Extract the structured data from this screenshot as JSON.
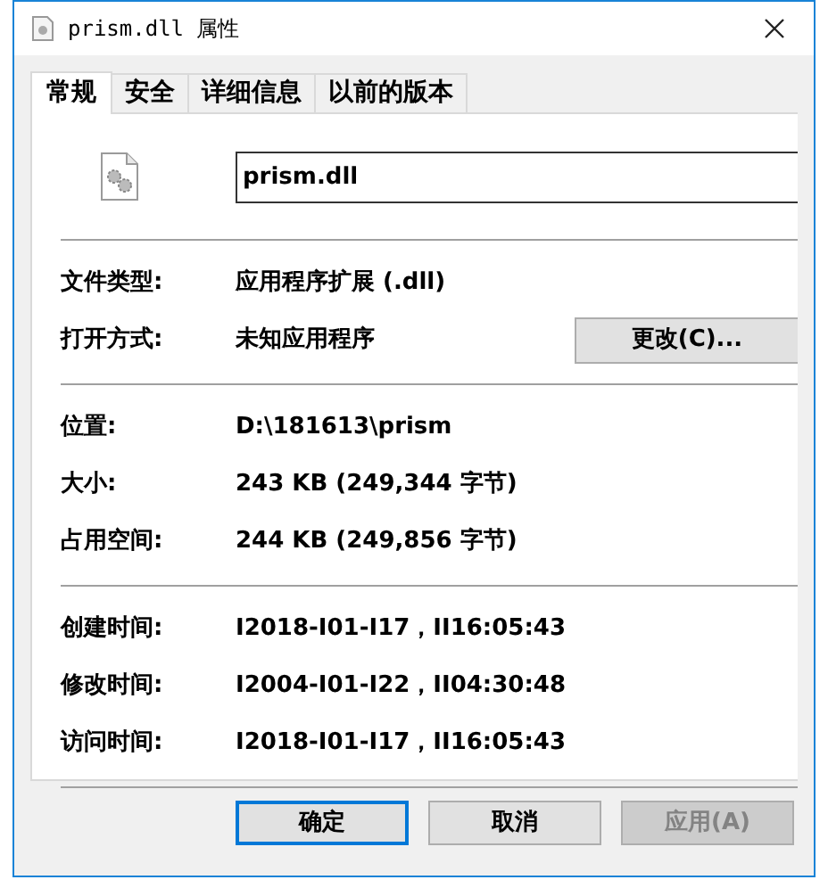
{
  "window": {
    "title": "prism.dll 属性"
  },
  "tabs": [
    {
      "label": "常规",
      "selected": true
    },
    {
      "label": "安全",
      "selected": false
    },
    {
      "label": "详细信息",
      "selected": false
    },
    {
      "label": "以前的版本",
      "selected": false
    }
  ],
  "file_name": {
    "value": "prism.dll"
  },
  "groups": [
    [
      {
        "label": "文件类型:",
        "value": "应用程序扩展 (.dll)"
      },
      {
        "label": "打开方式:",
        "value": "未知应用程序",
        "button": "更改(C)..."
      }
    ],
    [
      {
        "label": "位置:",
        "value": "D:\\181613\\prism"
      },
      {
        "label": "大小:",
        "value": "243 KB (249,344 字节)"
      },
      {
        "label": "占用空间:",
        "value": "244 KB (249,856 字节)"
      }
    ],
    [
      {
        "label": "创建时间:",
        "value": "I2018-I01-I17，II16:05:43"
      },
      {
        "label": "修改时间:",
        "value": "I2004-I01-I22，II04:30:48"
      },
      {
        "label": "访问时间:",
        "value": "I2018-I01-I17，II16:05:43"
      }
    ]
  ],
  "buttons": [
    {
      "label": "确定",
      "default": true,
      "disabled": false
    },
    {
      "label": "取消",
      "default": false,
      "disabled": false
    },
    {
      "label": "应用(A)",
      "default": false,
      "disabled": true
    }
  ]
}
